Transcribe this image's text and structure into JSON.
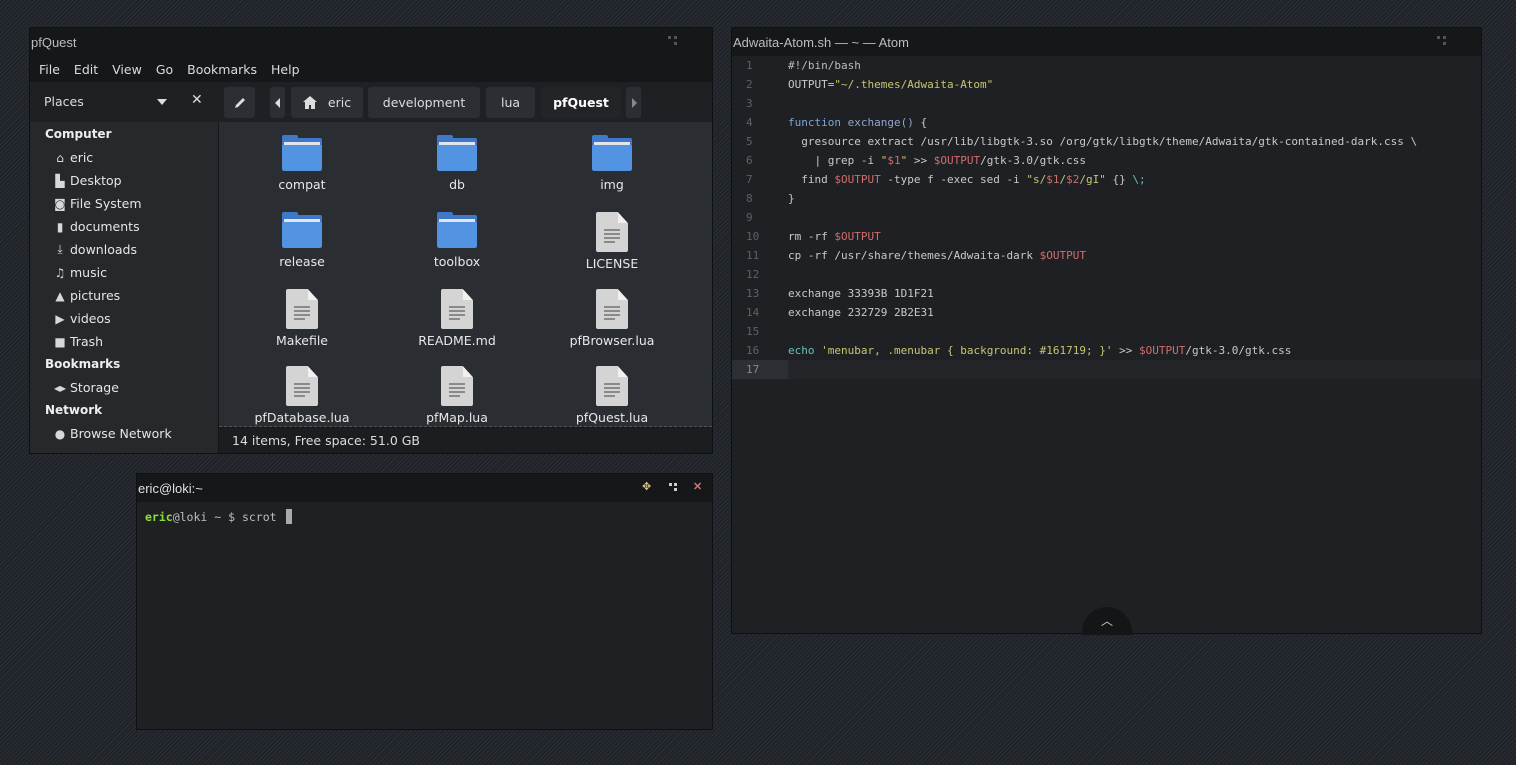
{
  "file_manager": {
    "title": "pfQuest",
    "menu": [
      "File",
      "Edit",
      "View",
      "Go",
      "Bookmarks",
      "Help"
    ],
    "places_label": "Places",
    "breadcrumb": [
      "eric",
      "development",
      "lua",
      "pfQuest"
    ],
    "sidebar": {
      "sections": [
        {
          "label": "Computer",
          "items": [
            {
              "label": "eric",
              "icon": "home-icon"
            },
            {
              "label": "Desktop",
              "icon": "desktop-icon"
            },
            {
              "label": "File System",
              "icon": "drive-icon"
            },
            {
              "label": "documents",
              "icon": "document-icon"
            },
            {
              "label": "downloads",
              "icon": "download-icon"
            },
            {
              "label": "music",
              "icon": "music-icon"
            },
            {
              "label": "pictures",
              "icon": "picture-icon"
            },
            {
              "label": "videos",
              "icon": "video-icon"
            },
            {
              "label": "Trash",
              "icon": "trash-icon"
            }
          ]
        },
        {
          "label": "Bookmarks",
          "items": [
            {
              "label": "Storage",
              "icon": "network-drive-icon"
            }
          ]
        },
        {
          "label": "Network",
          "items": [
            {
              "label": "Browse Network",
              "icon": "globe-icon"
            }
          ]
        }
      ]
    },
    "files": [
      {
        "name": "compat",
        "type": "folder"
      },
      {
        "name": "db",
        "type": "folder"
      },
      {
        "name": "img",
        "type": "folder"
      },
      {
        "name": "release",
        "type": "folder"
      },
      {
        "name": "toolbox",
        "type": "folder"
      },
      {
        "name": "LICENSE",
        "type": "file"
      },
      {
        "name": "Makefile",
        "type": "file"
      },
      {
        "name": "README.md",
        "type": "file"
      },
      {
        "name": "pfBrowser.lua",
        "type": "file"
      },
      {
        "name": "pfDatabase.lua",
        "type": "file"
      },
      {
        "name": "pfMap.lua",
        "type": "file"
      },
      {
        "name": "pfQuest.lua",
        "type": "file"
      }
    ],
    "status": "14 items, Free space: 51.0 GB"
  },
  "terminal": {
    "title": "eric@loki:~",
    "prompt_user": "eric",
    "prompt_rest": "@loki ~ $ ",
    "command": "scrot"
  },
  "atom": {
    "title": "Adwaita-Atom.sh — ~ — Atom",
    "current_line": 17,
    "lines": [
      [
        {
          "t": "#!/bin/bash",
          "c": "cmt"
        }
      ],
      [
        {
          "t": "OUTPUT=",
          "c": ""
        },
        {
          "t": "\"~/.themes/Adwaita-Atom\"",
          "c": "str"
        }
      ],
      [],
      [
        {
          "t": "function ",
          "c": "kw"
        },
        {
          "t": "exchange()",
          "c": "fn"
        },
        {
          "t": " {",
          "c": ""
        }
      ],
      [
        {
          "t": "  gresource extract /usr/lib/libgtk-3.so /org/gtk/libgtk/theme/Adwaita/gtk-contained-dark.css \\",
          "c": ""
        }
      ],
      [
        {
          "t": "    | grep -i ",
          "c": ""
        },
        {
          "t": "\"",
          "c": "str"
        },
        {
          "t": "$1",
          "c": "var"
        },
        {
          "t": "\"",
          "c": "str"
        },
        {
          "t": " >> ",
          "c": ""
        },
        {
          "t": "$OUTPUT",
          "c": "var"
        },
        {
          "t": "/gtk-3.0/gtk.css",
          "c": ""
        }
      ],
      [
        {
          "t": "  find ",
          "c": ""
        },
        {
          "t": "$OUTPUT",
          "c": "var"
        },
        {
          "t": " -type f -exec sed -i ",
          "c": ""
        },
        {
          "t": "\"s/",
          "c": "str"
        },
        {
          "t": "$1",
          "c": "var"
        },
        {
          "t": "/",
          "c": "str"
        },
        {
          "t": "$2",
          "c": "var"
        },
        {
          "t": "/gI\"",
          "c": "str"
        },
        {
          "t": " {} ",
          "c": ""
        },
        {
          "t": "\\;",
          "c": "echo"
        }
      ],
      [
        {
          "t": "}",
          "c": ""
        }
      ],
      [],
      [
        {
          "t": "rm -rf ",
          "c": ""
        },
        {
          "t": "$OUTPUT",
          "c": "var"
        }
      ],
      [
        {
          "t": "cp -rf /usr/share/themes/Adwaita-dark ",
          "c": ""
        },
        {
          "t": "$OUTPUT",
          "c": "var"
        }
      ],
      [],
      [
        {
          "t": "exchange 33393B 1D1F21",
          "c": ""
        }
      ],
      [
        {
          "t": "exchange 232729 2B2E31",
          "c": ""
        }
      ],
      [],
      [
        {
          "t": "echo ",
          "c": "echo"
        },
        {
          "t": "'menubar, .menubar { background: #161719; }'",
          "c": "str"
        },
        {
          "t": " >> ",
          "c": ""
        },
        {
          "t": "$OUTPUT",
          "c": "var"
        },
        {
          "t": "/gtk-3.0/gtk.css",
          "c": ""
        }
      ],
      []
    ]
  }
}
